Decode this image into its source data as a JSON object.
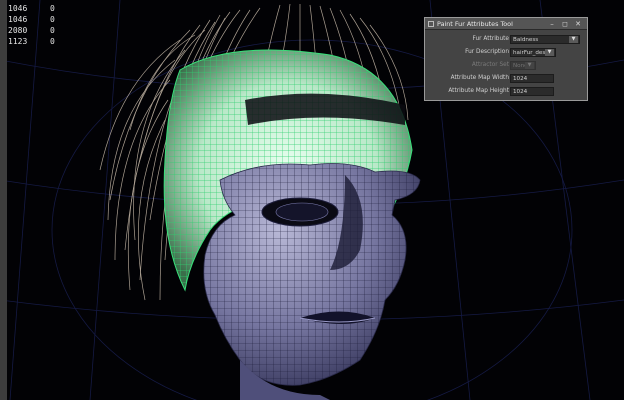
{
  "viewport": {
    "stats": [
      {
        "a": "1046",
        "b": "0"
      },
      {
        "a": "1046",
        "b": "0"
      },
      {
        "a": "2080",
        "b": "0"
      },
      {
        "a": "1123",
        "b": "0"
      }
    ]
  },
  "tool_window": {
    "title": "Paint Fur Attributes Tool",
    "fields": {
      "fur_attribute": {
        "label": "Fur Attribute",
        "value": "Baldness"
      },
      "fur_description": {
        "label": "Fur Description",
        "value": "hairFur_des"
      },
      "attractor_set": {
        "label": "Attractor Set",
        "value": "None"
      },
      "map_width": {
        "label": "Attribute Map Width",
        "value": "1024"
      },
      "map_height": {
        "label": "Attribute Map Height",
        "value": "1024"
      }
    }
  },
  "colors": {
    "background": "#020205",
    "mesh_fill": "#6e6e96",
    "wireframe_selected": "#39e07a",
    "fur": "#b7aa9a",
    "grid": "#1a1f4a"
  },
  "icons": [
    "app-icon",
    "minimize-icon",
    "maximize-icon",
    "close-icon"
  ]
}
